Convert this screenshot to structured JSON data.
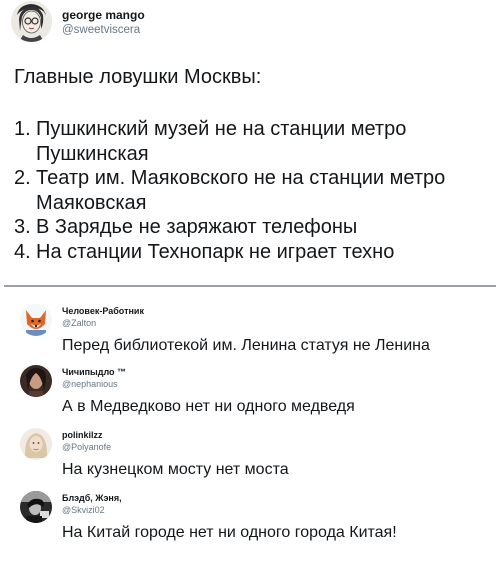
{
  "tweet": {
    "author_name": "george mango",
    "author_handle": "@sweetviscera",
    "intro": "Главные ловушки Москвы:",
    "items": [
      {
        "num": "1.",
        "text": "Пушкинский музей не на станции метро Пушкинская"
      },
      {
        "num": "2.",
        "text": "Театр им. Маяковского не на станции метро Маяковская"
      },
      {
        "num": "3.",
        "text": "В Зарядье не заряжают телефоны"
      },
      {
        "num": "4.",
        "text": "На станции Технопарк не играет техно"
      }
    ]
  },
  "replies": [
    {
      "name": "Человек-Работник",
      "handle": "@Zalton",
      "text": "Перед библиотекой им. Ленина статуя не Ленина",
      "avatar_icon": "fox-avatar-icon",
      "avatar_color": "#e0672a"
    },
    {
      "name": "Чичипыдло ™",
      "handle": "@nephanious",
      "text": "А в Медведково нет ни одного медведя",
      "avatar_icon": "portrait-avatar-icon",
      "avatar_color": "#3a2a24"
    },
    {
      "name": "polinkilzz",
      "handle": "@Polyanofe",
      "text": "На кузнецком мосту нет моста",
      "avatar_icon": "blonde-avatar-icon",
      "avatar_color": "#d9c7a8"
    },
    {
      "name": "Блэдб, Жэня,",
      "handle": "@Skvizi02",
      "text": "На Китай городе нет ни одного города Китая!",
      "avatar_icon": "dark-avatar-icon",
      "avatar_color": "#2a2a2a"
    }
  ],
  "colors": {
    "text": "#14171a",
    "secondary": "#657786",
    "divider": "#9aa0a6"
  }
}
